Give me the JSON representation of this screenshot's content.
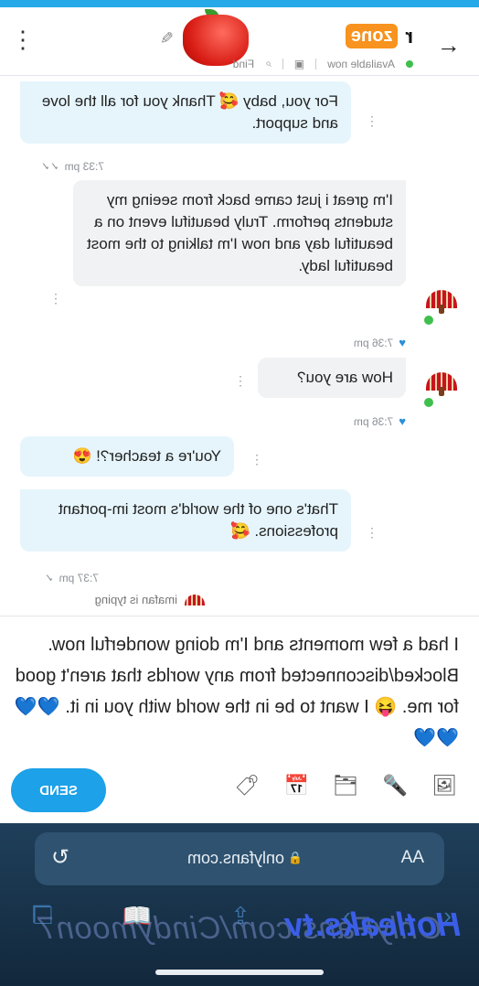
{
  "header": {
    "contact_name_visible": "zone",
    "contact_name_extra": "r",
    "status": "Available now",
    "find_label": "Find"
  },
  "messages": [
    {
      "side": "me",
      "text": "For you, baby 🥰 Thank you for all the love and support.",
      "time": "7:33 pm"
    },
    {
      "side": "them",
      "text": "I'm great i just came back from seeing my students perform. Truly beautiful event on a beautiful day and now I'm talking to the most beautiful lady.",
      "time": "7:36 pm"
    },
    {
      "side": "them",
      "text": "How are you?",
      "time": "7:36 pm"
    },
    {
      "side": "me",
      "text": "You're a teacher?! 😍",
      "time": ""
    },
    {
      "side": "me",
      "text": "That's one of the world's most im-portant professions. 🥰",
      "time": "7:37 pm"
    }
  ],
  "typing": "imafan is typing",
  "composer": {
    "text": "I had a few moments and I'm doing wonderful now. Blocked/disconnected from any worlds that aren't good for me. 😝 I want to be in the world with you in it. 💙💙💙💙",
    "send_label": "SEND"
  },
  "browser": {
    "aa": "AA",
    "url": "onlyfans.com",
    "watermark_left": "Hotleaks.tv",
    "watermark_right": "OnlyFans.com/Cindymoon7"
  },
  "colors": {
    "accent": "#1da1e8",
    "bubble_me": "#e6f5fc",
    "bubble_them": "#f1f2f4",
    "heart": "#2a8fd6"
  }
}
